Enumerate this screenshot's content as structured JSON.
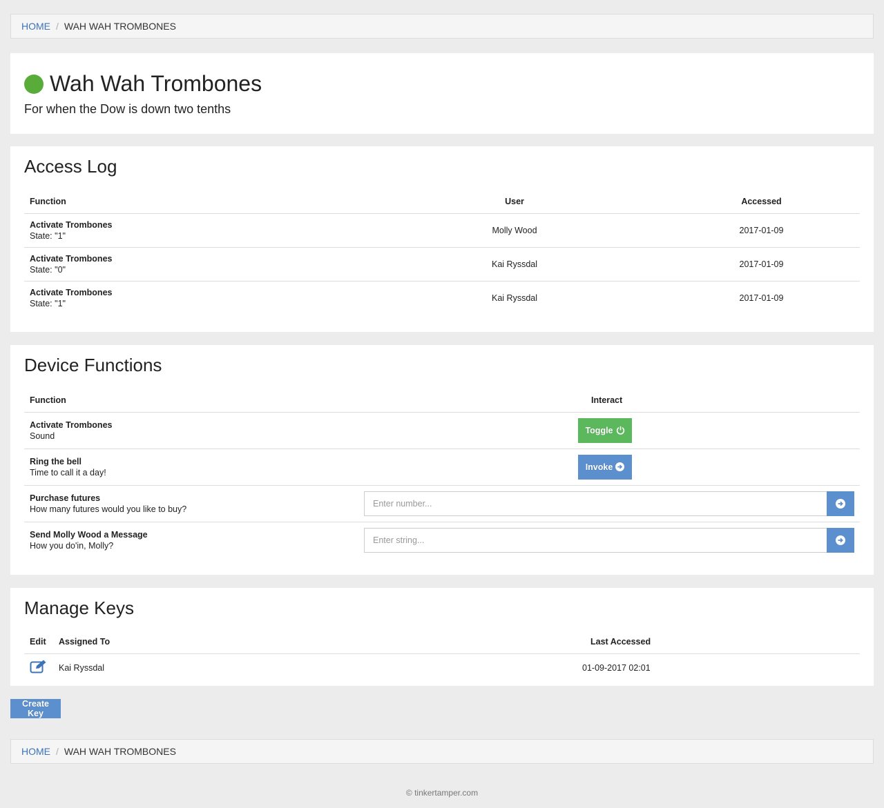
{
  "breadcrumb": {
    "home": "HOME",
    "separator": "/",
    "current": "WAH WAH TROMBONES"
  },
  "device": {
    "name": "Wah Wah Trombones",
    "description": "For when the Dow is down two tenths",
    "status_color": "#5aac3a"
  },
  "access_log": {
    "title": "Access Log",
    "headers": {
      "function": "Function",
      "user": "User",
      "accessed": "Accessed"
    },
    "rows": [
      {
        "function": "Activate Trombones",
        "state": "State: \"1\"",
        "user": "Molly Wood",
        "accessed": "2017-01-09"
      },
      {
        "function": "Activate Trombones",
        "state": "State: \"0\"",
        "user": "Kai Ryssdal",
        "accessed": "2017-01-09"
      },
      {
        "function": "Activate Trombones",
        "state": "State: \"1\"",
        "user": "Kai Ryssdal",
        "accessed": "2017-01-09"
      }
    ]
  },
  "device_functions": {
    "title": "Device Functions",
    "headers": {
      "function": "Function",
      "interact": "Interact"
    },
    "rows": [
      {
        "name": "Activate Trombones",
        "description": "Sound",
        "button_label": "Toggle"
      },
      {
        "name": "Ring the bell",
        "description": "Time to call it a day!",
        "button_label": "Invoke"
      },
      {
        "name": "Purchase futures",
        "description": "How many futures would you like to buy?",
        "placeholder": "Enter number..."
      },
      {
        "name": "Send Molly Wood a Message",
        "description": "How you do'in, Molly?",
        "placeholder": "Enter string..."
      }
    ]
  },
  "manage_keys": {
    "title": "Manage Keys",
    "headers": {
      "edit": "Edit",
      "assigned_to": "Assigned To",
      "last_accessed": "Last Accessed"
    },
    "rows": [
      {
        "assigned_to": "Kai Ryssdal",
        "last_accessed": "01-09-2017 02:01"
      }
    ]
  },
  "create_key_label": "Create Key",
  "footer": "© tinkertamper.com",
  "colors": {
    "green": "#5cb85c",
    "blue": "#5b8fcd",
    "link": "#3c73b6"
  },
  "icons": {
    "toggle": "power-icon",
    "invoke": "arrow-circle-right-icon",
    "submit": "arrow-circle-right-icon",
    "edit": "edit-icon"
  }
}
